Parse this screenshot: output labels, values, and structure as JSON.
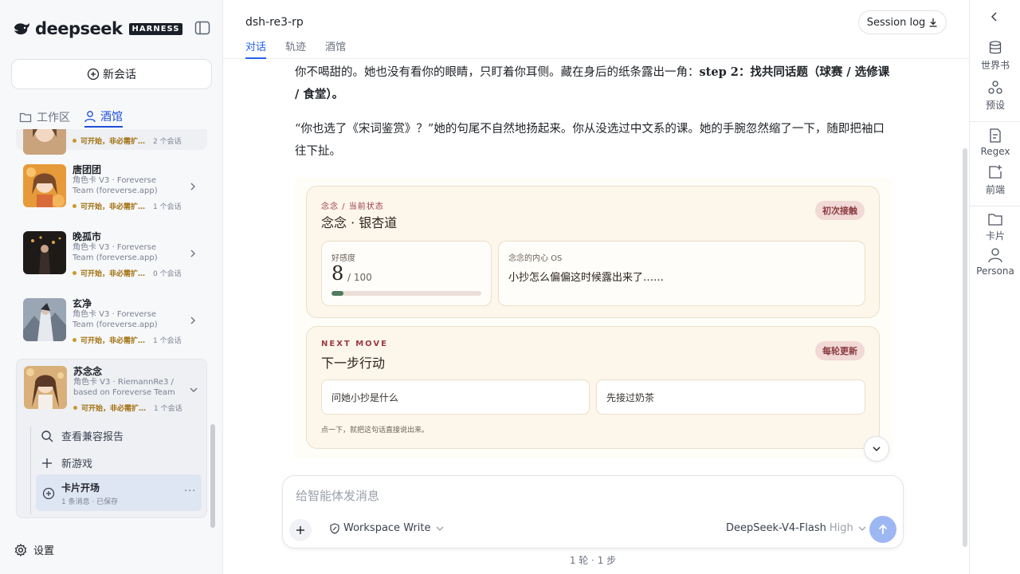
{
  "brand": {
    "name": "deepseek",
    "badge": "HARNESS"
  },
  "sidebar": {
    "new_chat_label": "新会话",
    "tabs": [
      {
        "label": "工作区",
        "icon": "folder-icon"
      },
      {
        "label": "酒馆",
        "icon": "person-icon",
        "active": true
      }
    ],
    "partial_item": {
      "status": "可开始，非必需扩…",
      "count": "2 个会话"
    },
    "characters": [
      {
        "name": "唐团团",
        "meta": "角色卡 V3 · Foreverse Team (foreverse.app)",
        "status": "可开始，非必需扩…",
        "count": "1 个会话"
      },
      {
        "name": "晚孤市",
        "meta": "角色卡 V3 · Foreverse Team (foreverse.app)",
        "status": "可开始，非必需扩…",
        "count": "0 个会话"
      },
      {
        "name": "玄净",
        "meta": "角色卡 V3 · Foreverse Team (foreverse.app)",
        "status": "可开始，非必需扩…",
        "count": "1 个会话"
      },
      {
        "name": "苏念念",
        "meta": "角色卡 V3 · RiemannRe3 / based on Foreverse Team",
        "status": "可开始，非必需扩…",
        "count": "1 个会话"
      }
    ],
    "expanded": {
      "report_label": "查看兼容报告",
      "new_game_label": "新游戏",
      "active_session": {
        "title": "卡片开场",
        "meta": "1 条消息 · 已保存"
      },
      "more": "···"
    },
    "settings_label": "设置"
  },
  "header": {
    "session_title": "dsh-re3-rp",
    "tabs": [
      "对话",
      "轨迹",
      "酒馆"
    ],
    "session_log_label": "Session log"
  },
  "chat": {
    "para1_a": "你不喝甜的。她也没有看你的眼睛，只盯着你耳侧。藏在身后的纸条露出一角：",
    "para1_b": "step 2：找共同话题（球赛 / 选修课 / 食堂）。",
    "para2": "“你也选了《宋词鉴赏》？”她的句尾不自然地扬起来。你从没选过中文系的课。她的手腕忽然缩了一下，随即把袖口往下扯。"
  },
  "status_card": {
    "eyebrow": "念念 / 当前状态",
    "title": "念念 · 银杏道",
    "badge": "初次接触",
    "affinity_label": "好感度",
    "affinity_value": "8",
    "affinity_max": "/ 100",
    "affinity_fraction": 0.08,
    "os_label": "念念的内心 OS",
    "os_text": "小抄怎么偏偏这时候露出来了……"
  },
  "move_card": {
    "eyebrow": "NEXT MOVE",
    "title": "下一步行动",
    "badge": "每轮更新",
    "options": [
      "问她小抄是什么",
      "先接过奶茶"
    ],
    "hint": "点一下，就把这句话直接说出来。"
  },
  "composer": {
    "placeholder": "给智能体发消息",
    "mode_label": "Workspace Write",
    "model_label": "DeepSeek-V4-Flash",
    "model_level": "High",
    "turn_info": "1 轮 · 1 步"
  },
  "rail": {
    "items": [
      {
        "label": "世界书",
        "icon": "database-icon"
      },
      {
        "label": "预设",
        "icon": "preset-icon"
      },
      {
        "label": "Regex",
        "icon": "regex-icon"
      },
      {
        "label": "前端",
        "icon": "frontend-icon"
      },
      {
        "label": "卡片",
        "icon": "folder-icon"
      },
      {
        "label": "Persona",
        "icon": "person-icon"
      }
    ]
  },
  "colors": {
    "accent": "#2563eb",
    "card_bg": "#fdf6ea",
    "badge_bg": "#f1d9d6",
    "badge_text": "#8a3a40",
    "affinity_fill": "#4f7a5e"
  }
}
